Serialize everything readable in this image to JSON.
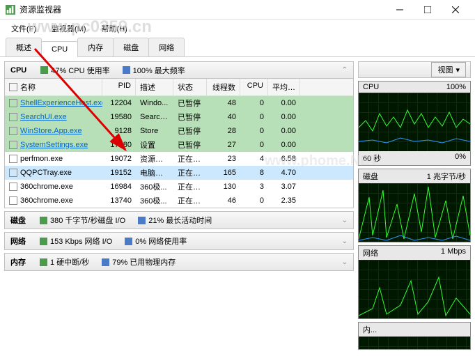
{
  "window": {
    "title": "资源监视器"
  },
  "menu": {
    "file": "文件(F)",
    "monitor": "监视器(M)",
    "help": "帮助(H)"
  },
  "tabs": {
    "overview": "概述",
    "cpu": "CPU",
    "memory": "内存",
    "disk": "磁盘",
    "network": "网络"
  },
  "cpu_panel": {
    "title": "CPU",
    "usage_label": "47% CPU 使用率",
    "freq_label": "100% 最大频率",
    "cols": {
      "name": "名称",
      "pid": "PID",
      "desc": "描述",
      "status": "状态",
      "threads": "线程数",
      "cpu": "CPU",
      "avg": "平均 C..."
    },
    "rows": [
      {
        "name": "ShellExperienceHost.exe",
        "pid": "12204",
        "desc": "Windo...",
        "status": "已暂停",
        "threads": "48",
        "cpu": "0",
        "avg": "0.00",
        "green": true,
        "link": true
      },
      {
        "name": "SearchUI.exe",
        "pid": "19580",
        "desc": "Search...",
        "status": "已暂停",
        "threads": "40",
        "cpu": "0",
        "avg": "0.00",
        "green": true,
        "link": true
      },
      {
        "name": "WinStore.App.exe",
        "pid": "9128",
        "desc": "Store",
        "status": "已暂停",
        "threads": "28",
        "cpu": "0",
        "avg": "0.00",
        "green": true,
        "link": true
      },
      {
        "name": "SystemSettings.exe",
        "pid": "17480",
        "desc": "设置",
        "status": "已暂停",
        "threads": "27",
        "cpu": "0",
        "avg": "0.00",
        "green": true,
        "link": true
      },
      {
        "name": "perfmon.exe",
        "pid": "19072",
        "desc": "资源和...",
        "status": "正在运行",
        "threads": "23",
        "cpu": "4",
        "avg": "6.58"
      },
      {
        "name": "QQPCTray.exe",
        "pid": "19152",
        "desc": "电脑管家",
        "status": "正在运行",
        "threads": "165",
        "cpu": "8",
        "avg": "4.70",
        "sel": true
      },
      {
        "name": "360chrome.exe",
        "pid": "16984",
        "desc": "360极...",
        "status": "正在运行",
        "threads": "130",
        "cpu": "3",
        "avg": "3.07"
      },
      {
        "name": "360chrome.exe",
        "pid": "13740",
        "desc": "360极...",
        "status": "正在运行",
        "threads": "46",
        "cpu": "0",
        "avg": "2.35"
      }
    ]
  },
  "disk_panel": {
    "title": "磁盘",
    "io": "380 千字节/秒磁盘 I/O",
    "active": "21% 最长活动时间"
  },
  "net_panel": {
    "title": "网络",
    "io": "153 Kbps 网络 I/O",
    "usage": "0% 网络使用率"
  },
  "mem_panel": {
    "title": "内存",
    "faults": "1 硬中断/秒",
    "used": "79% 已用物理内存"
  },
  "side": {
    "view_btn": "视图",
    "cpu": {
      "title": "CPU",
      "right": "100%",
      "footer_l": "60 秒",
      "footer_r": "0%"
    },
    "disk": {
      "title": "磁盘",
      "right": "1 兆字节/秒"
    },
    "net": {
      "title": "网络",
      "right": "1 Mbps"
    },
    "mem": {
      "title": "内..."
    }
  },
  "watermark": "www.pc0359.cn",
  "watermark2": "www.phome.NET"
}
